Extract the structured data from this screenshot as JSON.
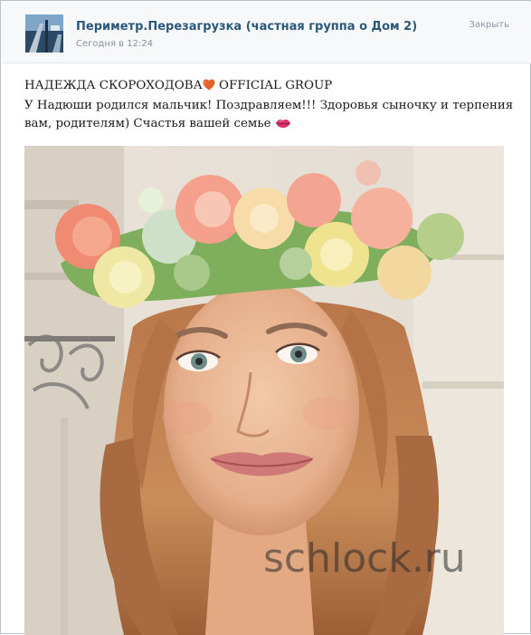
{
  "header": {
    "group_name": "Периметр.Перезагрузка (частная группа о Дом 2)",
    "time": "Сегодня в 12:24",
    "close_label": "Закрыть",
    "avatar_icon": "group-avatar-icon"
  },
  "post": {
    "title_prefix": "НАДЕЖДА СКОРОХОДОВА",
    "title_suffix": " OFFICIAL GROUP",
    "title_icon": "heart-icon",
    "line1": "У Надюши родился мальчик! Поздравляем!!! Здоровья сыночку и терпения",
    "line2": "вам, родителям) Счастья вашей семье",
    "line2_icon": "kiss-lips-icon"
  },
  "photo": {
    "description_icon": "photo-woman-flower-crown",
    "watermark": "schlock.ru"
  },
  "colors": {
    "link": "#2b587a",
    "muted": "#8a9199",
    "heart": "#e2632b",
    "lips": "#d9346b"
  }
}
